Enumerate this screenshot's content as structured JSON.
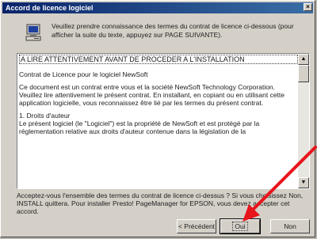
{
  "window": {
    "title": "Accord de licence logiciel",
    "close_glyph": "×"
  },
  "intro": {
    "text": "Veuillez prendre connaissance des termes du contrat de licence ci-dessous (pour afficher la suite du texte, appuyez sur PAGE SUIVANTE)."
  },
  "license": {
    "heading": "A LIRE ATTENTIVEMENT AVANT DE PROCEDER A L'INSTALLATION",
    "paragraphs": [
      "Contrat de Licence pour le logiciel NewSoft",
      "Ce document est un contrat entre vous et la société NewSoft Technology Corporation. Veuillez lire attentivement le présent contrat. En installant, en copiant ou en utilisant cette application logicielle, vous reconnaissez être lié par les termes du présent contrat.",
      "1. Droits d'auteur\n  Le présent logiciel (le \"Logiciel\") est la propriété de NewSoft et est protégé par la réglementation relative aux droits d'auteur contenue dans la législation de la"
    ]
  },
  "question": {
    "text": "Acceptez-vous l'ensemble des termes du contrat de licence ci-dessus ? Si vous choisissez Non, INSTALL quittera. Pour installer Presto! PageManager for EPSON, vous devez accepter cet accord."
  },
  "buttons": {
    "prev": "< Précédent",
    "yes": "Oui",
    "no": "Non"
  },
  "scrollbar": {
    "up_glyph": "▲",
    "down_glyph": "▼"
  },
  "colors": {
    "titlebar_start": "#0a246a",
    "titlebar_end": "#3a6ea5",
    "face": "#d4d0c8",
    "arrow": "#e8141c"
  }
}
